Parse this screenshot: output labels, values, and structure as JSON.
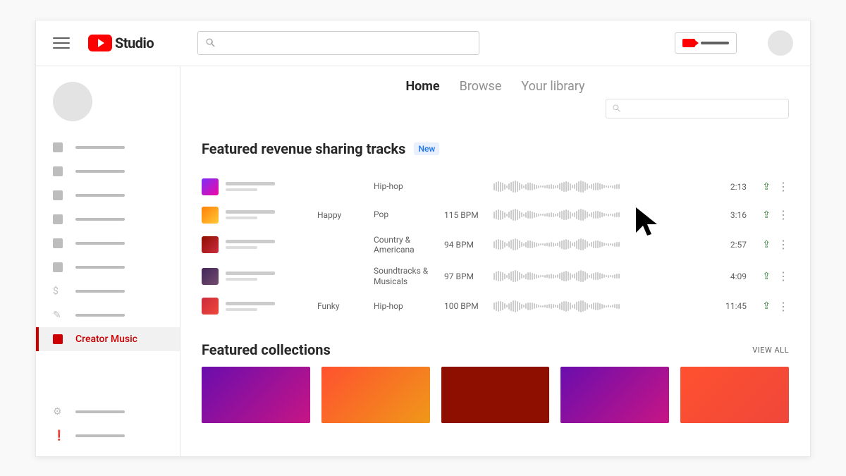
{
  "header": {
    "logo_text": "Studio"
  },
  "sidebar": {
    "active_label": "Creator Music",
    "items_count": 8,
    "footer_items_count": 2
  },
  "main": {
    "tabs": [
      {
        "label": "Home",
        "active": true
      },
      {
        "label": "Browse",
        "active": false
      },
      {
        "label": "Your library",
        "active": false
      }
    ],
    "section1": {
      "title": "Featured revenue sharing tracks",
      "badge": "New"
    },
    "tracks": [
      {
        "mood": "",
        "genre": "Hip-hop",
        "bpm": "",
        "duration": "2:13",
        "gradient": "g1"
      },
      {
        "mood": "Happy",
        "genre": "Pop",
        "bpm": "115 BPM",
        "duration": "3:16",
        "gradient": "g2"
      },
      {
        "mood": "",
        "genre": "Country & Americana",
        "bpm": "94 BPM",
        "duration": "2:57",
        "gradient": "g3"
      },
      {
        "mood": "",
        "genre": "Soundtracks & Musicals",
        "bpm": "97 BPM",
        "duration": "4:09",
        "gradient": "g4"
      },
      {
        "mood": "Funky",
        "genre": "Hip-hop",
        "bpm": "100 BPM",
        "duration": "11:45",
        "gradient": "g5"
      }
    ],
    "section2": {
      "title": "Featured collections",
      "view_all": "VIEW ALL"
    },
    "collections": [
      "cg1",
      "cg2",
      "cg3",
      "cg4",
      "cg5"
    ]
  }
}
